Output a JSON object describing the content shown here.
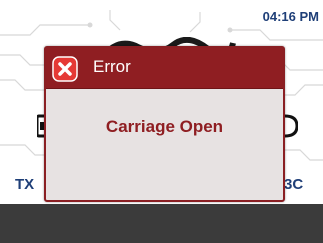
{
  "status_bar": {
    "time": "04:16 PM"
  },
  "background": {
    "model_left": "TX",
    "model_right": "3C",
    "icons": [
      "printer-icon",
      "printer-icon"
    ]
  },
  "dialog": {
    "title": "Error",
    "icon": "error-x-icon",
    "message": "Carriage Open",
    "colors": {
      "header": "#8f1e22",
      "body": "#e7e2e2",
      "message": "#8f1e22"
    }
  },
  "footer": {
    "color": "#3b3b3b"
  }
}
